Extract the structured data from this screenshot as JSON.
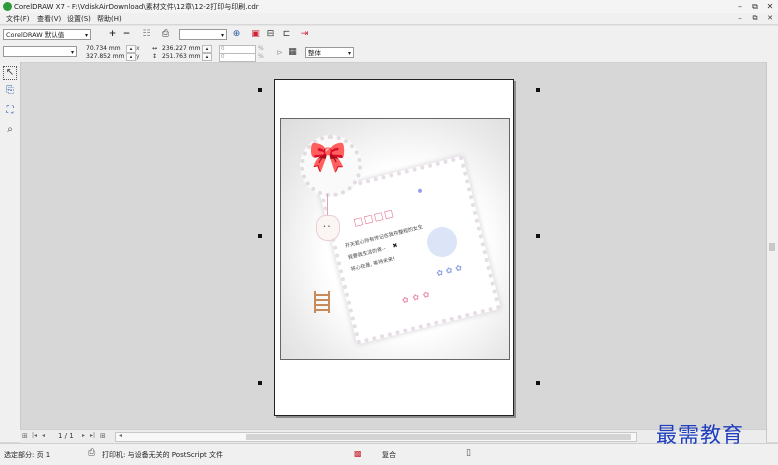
{
  "window": {
    "title": "CorelDRAW X7 - F:\\VdiskAirDownload\\素材文件\\12章\\12-2打印与印刷.cdr",
    "minimize": "–",
    "maximize": "⧉",
    "close": "✕"
  },
  "menu": {
    "items": [
      "文件(F)",
      "查看(V)",
      "设置(S)",
      "帮助(H)"
    ],
    "secondary_minimize": "–",
    "secondary_restore": "⧉",
    "secondary_close": "✕"
  },
  "toolbar": {
    "preset_combo": "CorelDRAW 默认值",
    "add": "+",
    "remove": "−",
    "zoom_combo": ""
  },
  "propbar": {
    "page_combo": "",
    "x": "70.734 mm",
    "y": "327.852 mm",
    "width": "236.227 mm",
    "height": "251.763 mm",
    "scale_x": "0",
    "scale_y": "0",
    "tiling_combo": "整体"
  },
  "nav": {
    "page_indicator": "1 / 1"
  },
  "status": {
    "selection": "选定部分: 页 1",
    "printer": "打印机: 与设备无关的 PostScript 文件",
    "composite": "复合"
  },
  "artwork": {
    "stamp_text": "□□□□",
    "poem_line1": "开天若心所有传记在我存整程的女生",
    "poem_line2": "我要我生活的青--",
    "poem_line3": "将心在是, 等待未来!"
  },
  "watermark": "最需教育",
  "colors": {
    "accent": "#2a5fa8",
    "bow": "#c21a55",
    "watermark": "#1f3fbf"
  }
}
